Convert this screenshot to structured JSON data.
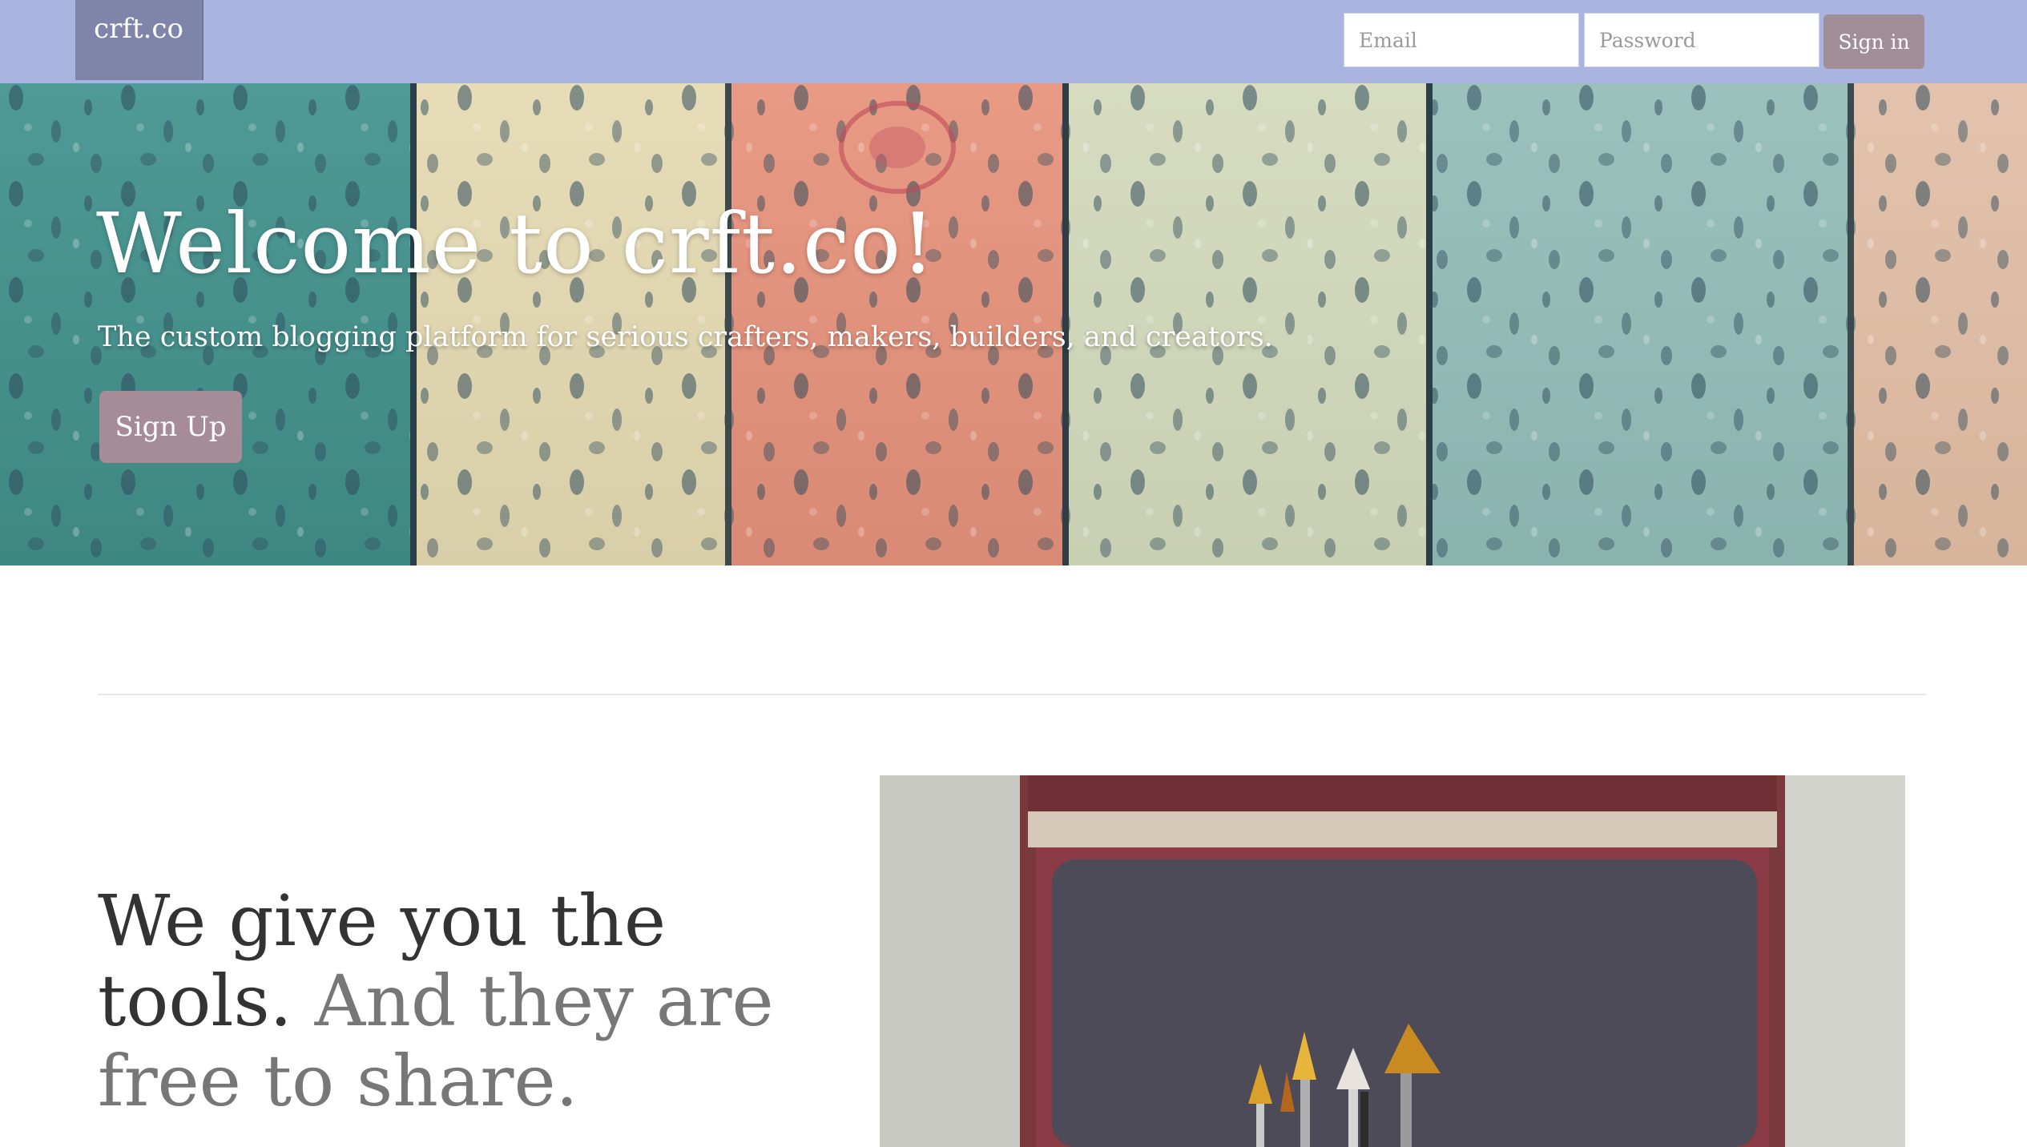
{
  "navbar": {
    "brand": "crft.co",
    "email_placeholder": "Email",
    "password_placeholder": "Password",
    "signin_label": "Sign in"
  },
  "hero": {
    "title": "Welcome to crft.co!",
    "subtitle": "The custom blogging platform for serious crafters, makers, builders, and creators.",
    "signup_label": "Sign Up"
  },
  "feature": {
    "heading_line1": "We give you the tools.",
    "heading_line2": "And they are free to share."
  },
  "colors": {
    "navbar_bg": "#a9b4e0",
    "brand_bg": "#7f85a8",
    "button_bg": "#a28e98",
    "heading_dark": "#333333",
    "heading_muted": "#777777"
  }
}
